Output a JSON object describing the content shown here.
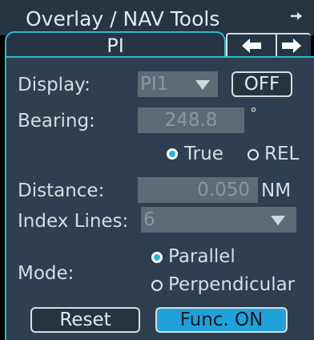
{
  "window": {
    "title": "Overlay / NAV Tools",
    "title_arrow_icon": "arrow-right-icon"
  },
  "tabs": {
    "active_label": "PI",
    "nav_left_icon": "arrow-left-icon",
    "nav_right_icon": "arrow-right-icon"
  },
  "display": {
    "label": "Display:",
    "value": "PI1",
    "toggle_label": "OFF"
  },
  "bearing": {
    "label": "Bearing:",
    "value": "248.8",
    "unit": "°",
    "reference_options": [
      {
        "label": "True",
        "selected": true
      },
      {
        "label": "REL",
        "selected": false
      }
    ]
  },
  "distance": {
    "label": "Distance:",
    "value": "0.050",
    "unit": "NM"
  },
  "index_lines": {
    "label": "Index Lines:",
    "value": "6"
  },
  "mode": {
    "label": "Mode:",
    "options": [
      {
        "label": "Parallel",
        "selected": true
      },
      {
        "label": "Perpendicular",
        "selected": false
      }
    ]
  },
  "buttons": {
    "reset": "Reset",
    "func": "Func. ON"
  },
  "colors": {
    "accent": "#33b8cc",
    "panel_bg": "#2d3f51",
    "field_bg": "#5d6b78",
    "func_on_bg": "#1fa2d9"
  }
}
